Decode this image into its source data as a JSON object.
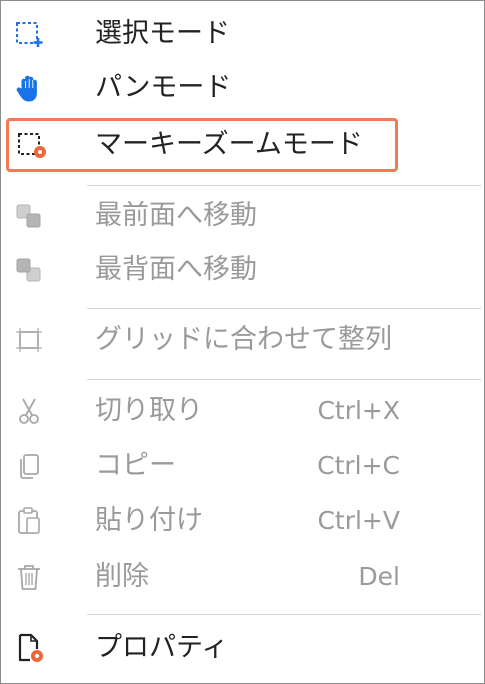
{
  "menu": {
    "items": [
      {
        "label": "選択モード",
        "icon": "selection-mode-icon"
      },
      {
        "label": "パンモード",
        "icon": "hand-pan-icon"
      },
      {
        "label": "マーキーズームモード",
        "icon": "marquee-zoom-icon"
      },
      {
        "label": "最前面へ移動",
        "icon": "bring-to-front-icon"
      },
      {
        "label": "最背面へ移動",
        "icon": "send-to-back-icon"
      },
      {
        "label": "グリッドに合わせて整列",
        "icon": "align-to-grid-icon"
      },
      {
        "label": "切り取り",
        "shortcut": "Ctrl+X",
        "icon": "scissors-icon"
      },
      {
        "label": "コピー",
        "shortcut": "Ctrl+C",
        "icon": "copy-icon"
      },
      {
        "label": "貼り付け",
        "shortcut": "Ctrl+V",
        "icon": "paste-icon"
      },
      {
        "label": "削除",
        "shortcut": "Del",
        "icon": "trash-icon"
      },
      {
        "label": "プロパティ",
        "icon": "properties-icon"
      }
    ]
  },
  "colors": {
    "highlight_border": "#f37a55",
    "accent_blue": "#1a73e8",
    "accent_orange": "#f0643a",
    "disabled_text": "#9a9a9a",
    "enabled_text": "#222222"
  }
}
